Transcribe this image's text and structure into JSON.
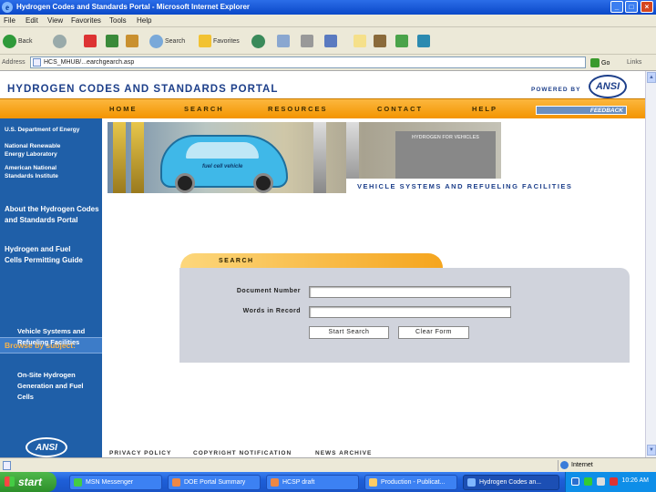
{
  "window": {
    "title": "Hydrogen Codes and Standards Portal - Microsoft Internet Explorer",
    "controls": {
      "minimize": "_",
      "maximize": "□",
      "close": "×"
    }
  },
  "menu": [
    "File",
    "Edit",
    "View",
    "Favorites",
    "Tools",
    "Help"
  ],
  "toolbar": {
    "back": "Back",
    "search": "Search",
    "favorites": "Favorites"
  },
  "address": {
    "label": "Address",
    "url": "HCS_MHUB/...earchgearch.asp",
    "go": "Go",
    "links": "Links"
  },
  "page": {
    "portal_title": "HYDROGEN CODES AND STANDARDS PORTAL",
    "powered_by": "POWERED BY",
    "ansi_logo": "ANSI",
    "nav": [
      "HOME",
      "SEARCH",
      "RESOURCES",
      "CONTACT",
      "HELP"
    ],
    "feedback": "FEEDBACK",
    "sidebar": {
      "orgs": [
        "U.S. Department of Energy",
        "National Renewable Energy Laboratory",
        "American National Standards Institute"
      ],
      "about": "About the Hydrogen Codes and Standards Portal",
      "guide": "Hydrogen and Fuel Cells Permitting Guide",
      "browse": "Browse by subject:",
      "subjects": [
        "Vehicle Systems and Refueling Facilities",
        "On-Site Hydrogen Generation and Fuel Cells"
      ],
      "ansi_logo": "ANSI"
    },
    "banner": {
      "sign": "HYDROGEN FOR VEHICLES",
      "car_text": "fuel cell vehicle",
      "caption": "VEHICLE SYSTEMS AND REFUELING FACILITIES"
    },
    "search": {
      "tab_label": "SEARCH",
      "doc_number_label": "Document Number",
      "words_label": "Words in Record",
      "doc_number_value": "",
      "words_value": "",
      "start_button": "Start Search",
      "clear_button": "Clear Form"
    },
    "footer": [
      "PRIVACY POLICY",
      "COPYRIGHT NOTIFICATION",
      "NEWS ARCHIVE"
    ]
  },
  "status": {
    "zone": "Internet"
  },
  "taskbar": {
    "start": "start",
    "tasks": [
      "MSN Messenger",
      "DOE Portal Summary",
      "HCSP draft",
      "Production - Publicat...",
      "Hydrogen Codes an..."
    ],
    "clock": "10:26 AM"
  },
  "colors": {
    "accent_orange": "#f39400",
    "sidebar_blue": "#1f5fa8",
    "title_blue": "#1d3f8a"
  }
}
